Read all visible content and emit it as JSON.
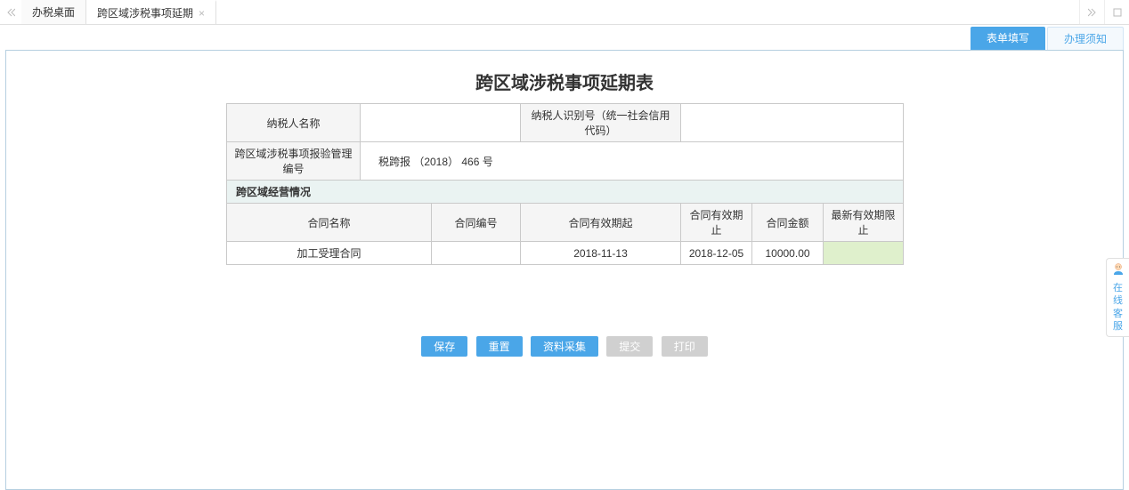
{
  "top_tabs": {
    "tab1": "办税桌面",
    "tab2": "跨区域涉税事项延期"
  },
  "secondary_tabs": {
    "fill": "表单填写",
    "notice": "办理须知"
  },
  "form": {
    "title": "跨区域涉税事项延期表",
    "labels": {
      "taxpayer_name": "纳税人名称",
      "taxpayer_id": "纳税人识别号（统一社会信用代码）",
      "management_no": "跨区域涉税事项报验管理编号",
      "section": "跨区域经营情况",
      "contract_name": "合同名称",
      "contract_no": "合同编号",
      "valid_from": "合同有效期起",
      "valid_to": "合同有效期止",
      "amount": "合同金额",
      "new_valid_to": "最新有效期限止"
    },
    "values": {
      "taxpayer_name": "",
      "taxpayer_id": "",
      "management_no": "税跨报 （2018） 466 号",
      "contract_name": "加工受理合同",
      "contract_no": "",
      "valid_from": "2018-11-13",
      "valid_to": "2018-12-05",
      "amount": "10000.00",
      "new_valid_to": ""
    }
  },
  "buttons": {
    "save": "保存",
    "reset": "重置",
    "collect": "资料采集",
    "submit": "提交",
    "print": "打印"
  },
  "help": {
    "label": "在线客服"
  }
}
